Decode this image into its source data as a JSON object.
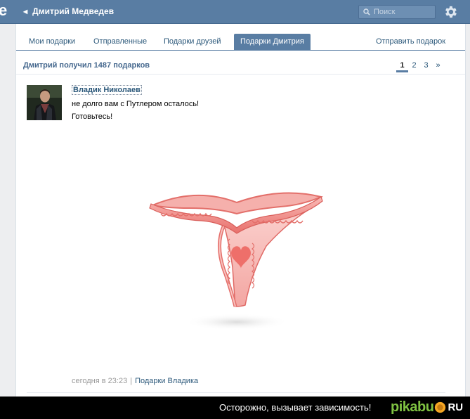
{
  "topbar": {
    "logo_fragment": "e",
    "back_label": "Дмитрий Медведев",
    "search_placeholder": "Поиск"
  },
  "tabs": [
    {
      "label": "Мои подарки",
      "active": false
    },
    {
      "label": "Отправленные",
      "active": false
    },
    {
      "label": "Подарки друзей",
      "active": false
    },
    {
      "label": "Подарки Дмитрия",
      "active": true
    }
  ],
  "send_gift_label": "Отправить подарок",
  "gifts_header": "Дмитрий получил 1487 подарков",
  "pager": {
    "pages": [
      "1",
      "2",
      "3"
    ],
    "current": "1",
    "next": "»"
  },
  "gift_item": {
    "sender": "Владик Николаев",
    "message_line1": "не долго вам с Путлером осталось!",
    "message_line2": "Готовьтесь!",
    "time": "сегодня в 23:23",
    "separator": "|",
    "sender_gifts_link": "Подарки Владика"
  },
  "banner": {
    "slogan": "Осторожно, вызывает зависимость!",
    "logo_text": "pikabu",
    "logo_domain": "RU"
  },
  "colors": {
    "topbar": "#597da3",
    "link": "#2b587a",
    "gift_pink": "#f08a86",
    "pikabu_green": "#7fc242"
  }
}
